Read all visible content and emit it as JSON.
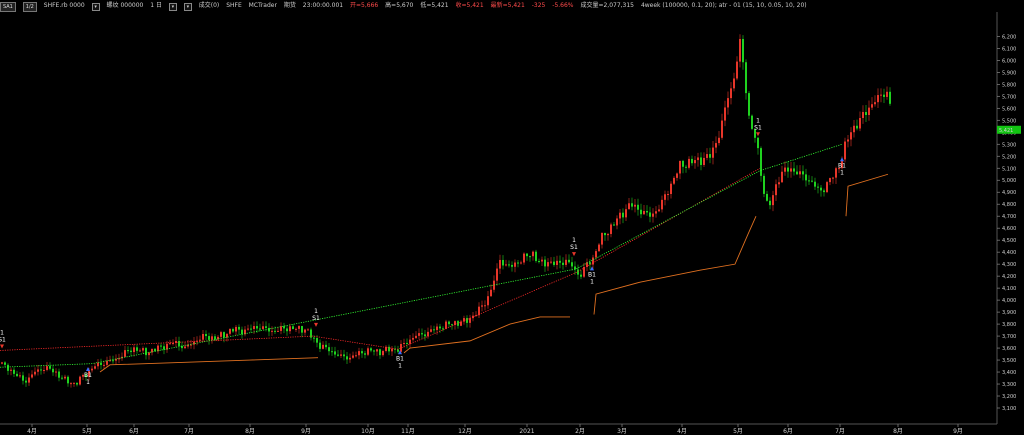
{
  "header": {
    "btn1": "SA1",
    "btn2": "1/2",
    "symbol": "SHFE.rb 0000",
    "period_label": "螺纹 000000",
    "interval": "1 日",
    "indicator_name": "成交(0)",
    "source": "SHFE",
    "platform": "MCTrader",
    "date_label": "期货",
    "time": "23:00:00.001",
    "open": "开=5,666",
    "high": "高=5,670",
    "low": "低=5,421",
    "close": "收=5,421",
    "last": "最新=5,421",
    "change": "-325",
    "change_pct": "-5.66%",
    "volume": "成交量=2,077,315",
    "strategy": "4week (100000, 0.1, 20); atr - 01 (15, 10, 0.05, 10, 20)"
  },
  "colors": {
    "up": "#e8362a",
    "down": "#1fd21f",
    "stop": "#e07020",
    "last_price_bg": "#12c412",
    "marker_text": "#ffffff",
    "trend_red": "#ff2a2a",
    "trend_green": "#33ff33"
  },
  "axes": {
    "y_ticks": [
      "6,200",
      "6,100",
      "6,000",
      "5,900",
      "5,800",
      "5,700",
      "5,600",
      "5,500",
      "5,400",
      "5,300",
      "5,200",
      "5,100",
      "5,000",
      "4,900",
      "4,800",
      "4,700",
      "4,600",
      "4,500",
      "4,400",
      "4,300",
      "4,200",
      "4,100",
      "4,000",
      "3,900",
      "3,800",
      "3,700",
      "3,600",
      "3,500",
      "3,400",
      "3,300",
      "3,200",
      "3,100"
    ],
    "x_ticks": [
      "4月",
      "5月",
      "6月",
      "7月",
      "8月",
      "9月",
      "10月",
      "11月",
      "12月",
      "2021",
      "2月",
      "3月",
      "4月",
      "5月",
      "6月",
      "7月",
      "8月",
      "9月"
    ],
    "last_price": "5,421"
  },
  "chart_data": {
    "type": "candlestick",
    "y_range": [
      3050,
      6320
    ],
    "x_ticks": [
      "4月",
      "5月",
      "6月",
      "7月",
      "8月",
      "9月",
      "10月",
      "11月",
      "12月",
      "2021",
      "2月",
      "3月",
      "4月",
      "5月",
      "6月",
      "7月",
      "8月",
      "9月"
    ],
    "close_path": [
      [
        0,
        3470
      ],
      [
        10,
        3420
      ],
      [
        20,
        3350
      ],
      [
        25,
        3320
      ],
      [
        35,
        3400
      ],
      [
        45,
        3440
      ],
      [
        55,
        3400
      ],
      [
        65,
        3330
      ],
      [
        75,
        3300
      ],
      [
        85,
        3380
      ],
      [
        95,
        3450
      ],
      [
        105,
        3480
      ],
      [
        115,
        3500
      ],
      [
        125,
        3560
      ],
      [
        135,
        3600
      ],
      [
        145,
        3560
      ],
      [
        155,
        3590
      ],
      [
        165,
        3620
      ],
      [
        175,
        3650
      ],
      [
        185,
        3600
      ],
      [
        195,
        3660
      ],
      [
        205,
        3700
      ],
      [
        215,
        3680
      ],
      [
        225,
        3720
      ],
      [
        235,
        3760
      ],
      [
        245,
        3740
      ],
      [
        255,
        3780
      ],
      [
        265,
        3760
      ],
      [
        275,
        3740
      ],
      [
        285,
        3770
      ],
      [
        295,
        3760
      ],
      [
        305,
        3760
      ],
      [
        312,
        3690
      ],
      [
        320,
        3620
      ],
      [
        330,
        3580
      ],
      [
        340,
        3530
      ],
      [
        350,
        3520
      ],
      [
        360,
        3560
      ],
      [
        370,
        3580
      ],
      [
        380,
        3570
      ],
      [
        390,
        3590
      ],
      [
        398,
        3590
      ],
      [
        405,
        3640
      ],
      [
        415,
        3700
      ],
      [
        425,
        3720
      ],
      [
        435,
        3760
      ],
      [
        445,
        3790
      ],
      [
        455,
        3810
      ],
      [
        465,
        3820
      ],
      [
        475,
        3880
      ],
      [
        485,
        3980
      ],
      [
        492,
        4100
      ],
      [
        500,
        4340
      ],
      [
        508,
        4270
      ],
      [
        516,
        4310
      ],
      [
        524,
        4350
      ],
      [
        532,
        4400
      ],
      [
        540,
        4300
      ],
      [
        548,
        4320
      ],
      [
        556,
        4300
      ],
      [
        566,
        4330
      ],
      [
        572,
        4280
      ],
      [
        580,
        4200
      ],
      [
        586,
        4290
      ],
      [
        592,
        4330
      ],
      [
        600,
        4500
      ],
      [
        610,
        4600
      ],
      [
        620,
        4700
      ],
      [
        630,
        4800
      ],
      [
        640,
        4750
      ],
      [
        650,
        4700
      ],
      [
        660,
        4780
      ],
      [
        670,
        4950
      ],
      [
        680,
        5120
      ],
      [
        690,
        5150
      ],
      [
        700,
        5170
      ],
      [
        710,
        5200
      ],
      [
        720,
        5400
      ],
      [
        728,
        5700
      ],
      [
        734,
        5850
      ],
      [
        740,
        6150
      ],
      [
        745,
        5850
      ],
      [
        750,
        5450
      ],
      [
        756,
        5350
      ],
      [
        762,
        5000
      ],
      [
        768,
        4750
      ],
      [
        774,
        4900
      ],
      [
        780,
        5050
      ],
      [
        790,
        5100
      ],
      [
        800,
        5050
      ],
      [
        810,
        5000
      ],
      [
        820,
        4900
      ],
      [
        830,
        5000
      ],
      [
        838,
        5100
      ],
      [
        844,
        5250
      ],
      [
        850,
        5400
      ],
      [
        860,
        5500
      ],
      [
        870,
        5620
      ],
      [
        880,
        5700
      ],
      [
        888,
        5750
      ],
      [
        893,
        5421
      ]
    ],
    "trend_red": [
      [
        0,
        3580
      ],
      [
        313,
        3700
      ],
      [
        398,
        3590
      ],
      [
        576,
        4230
      ],
      [
        760,
        5100
      ]
    ],
    "trend_green": [
      [
        0,
        3440
      ],
      [
        92,
        3470
      ],
      [
        576,
        4260
      ],
      [
        760,
        5080
      ],
      [
        842,
        5300
      ]
    ],
    "stop_line": [
      [
        [
          100,
          3400
        ],
        [
          110,
          3460
        ],
        [
          250,
          3500
        ],
        [
          318,
          3520
        ]
      ],
      [
        [
          404,
          3560
        ],
        [
          410,
          3600
        ],
        [
          470,
          3660
        ],
        [
          510,
          3800
        ],
        [
          540,
          3860
        ],
        [
          570,
          3860
        ]
      ],
      [
        [
          594,
          3880
        ],
        [
          596,
          4050
        ],
        [
          640,
          4150
        ],
        [
          700,
          4250
        ],
        [
          735,
          4300
        ],
        [
          748,
          4550
        ],
        [
          756,
          4700
        ]
      ],
      [
        [
          846,
          4700
        ],
        [
          848,
          4950
        ],
        [
          888,
          5050
        ]
      ]
    ],
    "signals": [
      {
        "date": "4月初",
        "type": "S1",
        "price": 3580
      },
      {
        "date": "5月",
        "type": "B1",
        "price": 3450
      },
      {
        "date": "9月",
        "type": "S1",
        "price": 3760
      },
      {
        "date": "11月",
        "type": "B1",
        "price": 3590
      },
      {
        "date": "2021-2月",
        "type": "S1",
        "price": 4350
      },
      {
        "date": "2021-2月",
        "type": "B1",
        "price": 4290
      },
      {
        "date": "2021-5月",
        "type": "S1",
        "price": 5350
      },
      {
        "date": "2021-7月",
        "type": "B1",
        "price": 5200
      }
    ],
    "last_price": 5421
  }
}
